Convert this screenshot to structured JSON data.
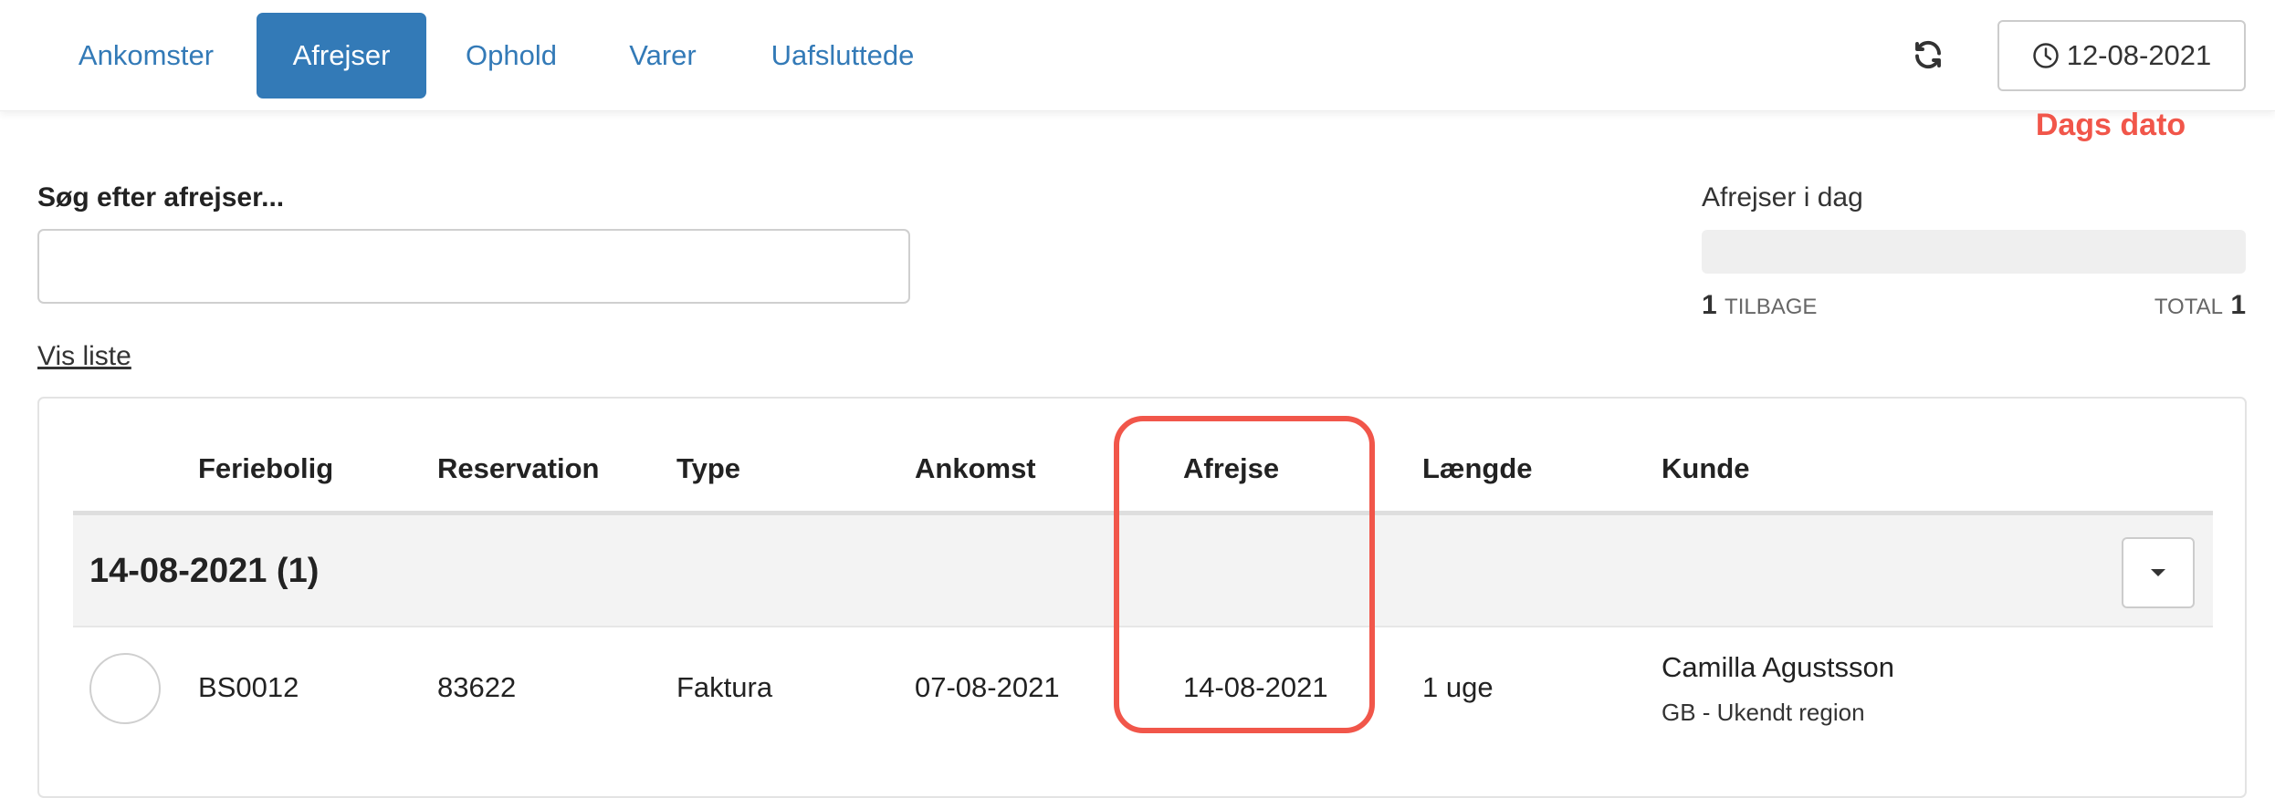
{
  "nav": {
    "tabs": [
      {
        "label": "Ankomster"
      },
      {
        "label": "Afrejser"
      },
      {
        "label": "Ophold"
      },
      {
        "label": "Varer"
      },
      {
        "label": "Uafsluttede"
      }
    ],
    "active_tab": "Afrejser",
    "date_button": "12-08-2021",
    "date_annotation": "Dags dato"
  },
  "search": {
    "label": "Søg efter afrejser...",
    "value": "",
    "placeholder": ""
  },
  "vis_liste": "Vis liste",
  "progress": {
    "label": "Afrejser i dag",
    "remaining_count": "1",
    "remaining_label": "TILBAGE",
    "total_label": "TOTAL",
    "total_count": "1",
    "fill_fraction": 0
  },
  "table": {
    "headers": [
      "Feriebolig",
      "Reservation",
      "Type",
      "Ankomst",
      "Afrejse",
      "Længde",
      "Kunde"
    ],
    "group": {
      "title": "14-08-2021 (1)"
    },
    "rows": [
      {
        "feriebolig": "BS0012",
        "reservation": "83622",
        "type": "Faktura",
        "ankomst": "07-08-2021",
        "afrejse": "14-08-2021",
        "laengde": "1 uge",
        "kunde": "Camilla Agustsson",
        "region": "GB - Ukendt region"
      }
    ]
  },
  "colors": {
    "accent": "#337ab7",
    "annotation": "#f1564a"
  },
  "icons": {
    "refresh": "refresh-icon",
    "clock": "clock-icon",
    "caret": "caret-down-icon"
  }
}
